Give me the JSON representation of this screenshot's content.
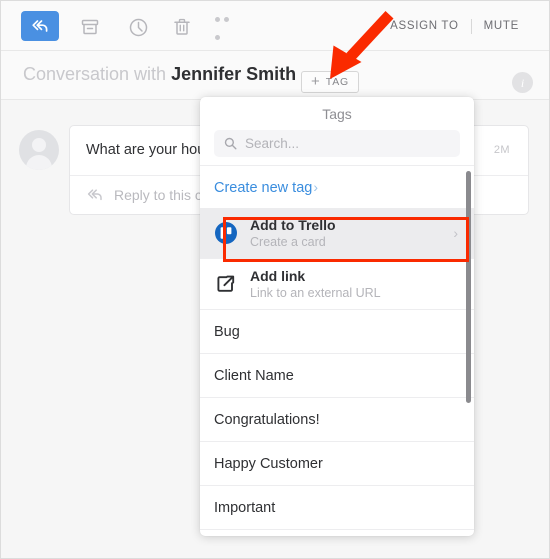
{
  "toolbar": {
    "reply_icon": "reply-all-icon",
    "archive_icon": "archive-icon",
    "snooze_icon": "clock-icon",
    "delete_icon": "trash-icon",
    "more_icon": "more-horizontal-icon",
    "assign_to": "ASSIGN TO",
    "mute": "MUTE"
  },
  "conversation": {
    "prefix": "Conversation with",
    "contact_name": "Jennifer Smith",
    "tag_button": {
      "plus": "+",
      "label": "TAG",
      "icon": "plus-icon"
    },
    "info_icon_letter": "i"
  },
  "message": {
    "avatar_icon": "user-avatar-icon",
    "text": "What are your hours for walk-in appointment?",
    "timestamp": "2M",
    "reply_placeholder": "Reply to this conversation",
    "reply_icon": "reply-icon"
  },
  "tags_dropdown": {
    "title": "Tags",
    "search": {
      "placeholder": "Search...",
      "value": "",
      "icon": "search-icon"
    },
    "create_new": {
      "label": "Create new tag",
      "chevron": "›"
    },
    "apps": [
      {
        "title": "Add to Trello",
        "subtitle": "Create a card",
        "icon": "trello-icon",
        "chevron": "›",
        "selected": true
      },
      {
        "title": "Add link",
        "subtitle": "Link to an external URL",
        "icon": "external-link-icon",
        "chevron": "",
        "selected": false
      }
    ],
    "tags": [
      "Bug",
      "Client Name",
      "Congratulations!",
      "Happy Customer",
      "Important"
    ],
    "scrollbar": "vertical-scrollbar"
  },
  "annotation": {
    "arrow_icon": "red-arrow-annotation",
    "highlight_icon": "red-highlight-box"
  },
  "colors": {
    "accent_blue": "#4a90e2",
    "link_blue": "#3a8dde",
    "annotation_red": "#fa2a00",
    "trello_blue": "#1566c0",
    "panel_bg": "#ffffff",
    "page_bg": "#f6f6f6"
  }
}
